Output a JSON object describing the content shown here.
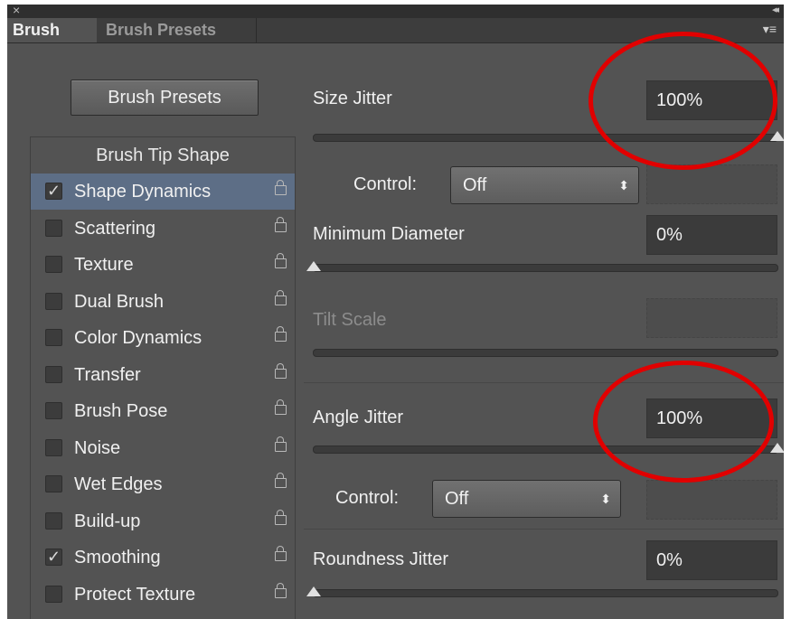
{
  "window": {
    "close_glyph": "×",
    "collapse_glyph": "◂◂"
  },
  "tabs": [
    {
      "label": "Brush"
    },
    {
      "label": "Brush Presets"
    }
  ],
  "panel_menu_glyph": "▾≡",
  "presets_button": "Brush Presets",
  "tip_list": {
    "header": "Brush Tip Shape",
    "items": [
      {
        "label": "Shape Dynamics",
        "checked": true,
        "selected": true
      },
      {
        "label": "Scattering",
        "checked": false
      },
      {
        "label": "Texture",
        "checked": false
      },
      {
        "label": "Dual Brush",
        "checked": false
      },
      {
        "label": "Color Dynamics",
        "checked": false
      },
      {
        "label": "Transfer",
        "checked": false
      },
      {
        "label": "Brush Pose",
        "checked": false
      },
      {
        "label": "Noise",
        "checked": false
      },
      {
        "label": "Wet Edges",
        "checked": false
      },
      {
        "label": "Build-up",
        "checked": false
      },
      {
        "label": "Smoothing",
        "checked": true
      },
      {
        "label": "Protect Texture",
        "checked": false
      }
    ]
  },
  "settings": {
    "size_jitter": {
      "label": "Size Jitter",
      "value": "100%",
      "level": 1.0
    },
    "control1": {
      "label": "Control:",
      "value": "Off"
    },
    "min_diameter": {
      "label": "Minimum Diameter",
      "value": "0%",
      "level": 0.0
    },
    "tilt_scale": {
      "label": "Tilt Scale",
      "value": "",
      "enabled": false
    },
    "angle_jitter": {
      "label": "Angle Jitter",
      "value": "100%",
      "level": 1.0
    },
    "control2": {
      "label": "Control:",
      "value": "Off"
    },
    "roundness_jitter": {
      "label": "Roundness Jitter",
      "value": "0%",
      "level": 0.0
    }
  },
  "annotation_color": "#e10000"
}
